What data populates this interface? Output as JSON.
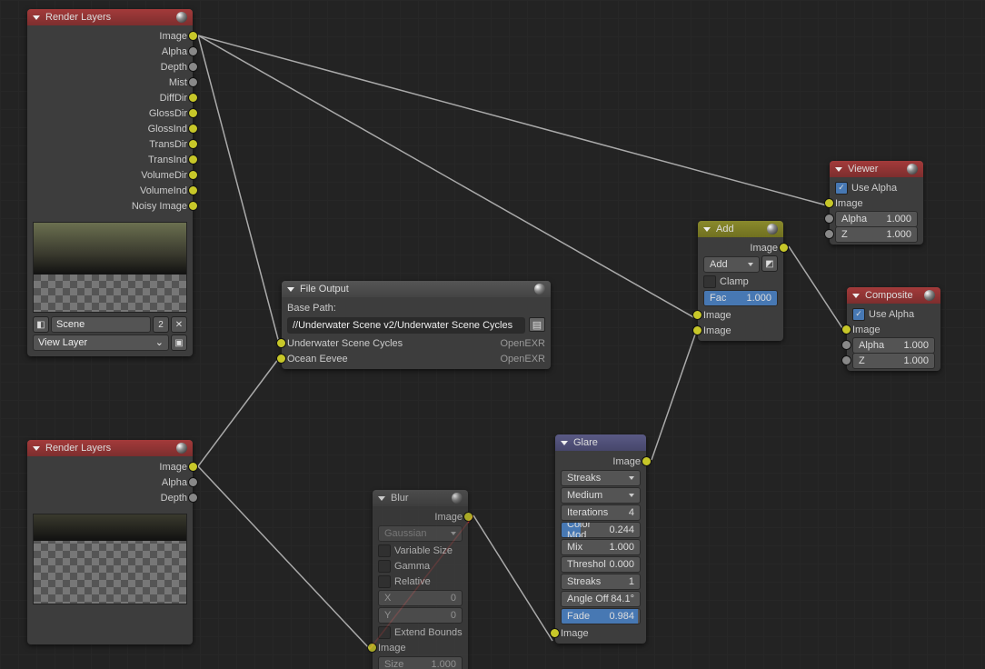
{
  "rl1": {
    "title": "Render Layers",
    "outs": [
      "Image",
      "Alpha",
      "Depth",
      "Mist",
      "DiffDir",
      "GlossDir",
      "GlossInd",
      "TransDir",
      "TransInd",
      "VolumeDir",
      "VolumeInd",
      "Noisy Image"
    ],
    "scene": "Scene",
    "scene_num": "2",
    "layer": "View Layer"
  },
  "rl2": {
    "title": "Render Layers",
    "outs": [
      "Image",
      "Alpha",
      "Depth"
    ]
  },
  "file": {
    "title": "File Output",
    "base_label": "Base Path:",
    "path": "//Underwater Scene v2/Underwater Scene Cycles",
    "rows": [
      {
        "name": "Underwater Scene Cycles",
        "fmt": "OpenEXR"
      },
      {
        "name": "Ocean Eevee",
        "fmt": "OpenEXR"
      }
    ]
  },
  "blur": {
    "title": "Blur",
    "out": "Image",
    "type": "Gaussian",
    "varsize": "Variable Size",
    "gamma": "Gamma",
    "relative": "Relative",
    "x": {
      "l": "X",
      "v": "0"
    },
    "y": {
      "l": "Y",
      "v": "0"
    },
    "extend": "Extend Bounds",
    "in_img": "Image",
    "size": {
      "l": "Size",
      "v": "1.000"
    }
  },
  "glare": {
    "title": "Glare",
    "out": "Image",
    "type": "Streaks",
    "quality": "Medium",
    "iter": {
      "l": "Iterations",
      "v": "4"
    },
    "cmod": {
      "l": "Color Mod",
      "v": "0.244"
    },
    "mix": {
      "l": "Mix",
      "v": "1.000"
    },
    "thr": {
      "l": "Threshol",
      "v": "0.000"
    },
    "str": {
      "l": "Streaks",
      "v": "1"
    },
    "ang": {
      "l": "Angle Off",
      "v": "84.1°"
    },
    "fade": {
      "l": "Fade",
      "v": "0.984"
    },
    "in_img": "Image"
  },
  "add": {
    "title": "Add",
    "out": "Image",
    "mode": "Add",
    "clamp": "Clamp",
    "fac": {
      "l": "Fac",
      "v": "1.000"
    },
    "img1": "Image",
    "img2": "Image"
  },
  "viewer": {
    "title": "Viewer",
    "usealpha": "Use Alpha",
    "img": "Image",
    "alpha": {
      "l": "Alpha",
      "v": "1.000"
    },
    "z": {
      "l": "Z",
      "v": "1.000"
    }
  },
  "comp": {
    "title": "Composite",
    "usealpha": "Use Alpha",
    "img": "Image",
    "alpha": {
      "l": "Alpha",
      "v": "1.000"
    },
    "z": {
      "l": "Z",
      "v": "1.000"
    }
  }
}
